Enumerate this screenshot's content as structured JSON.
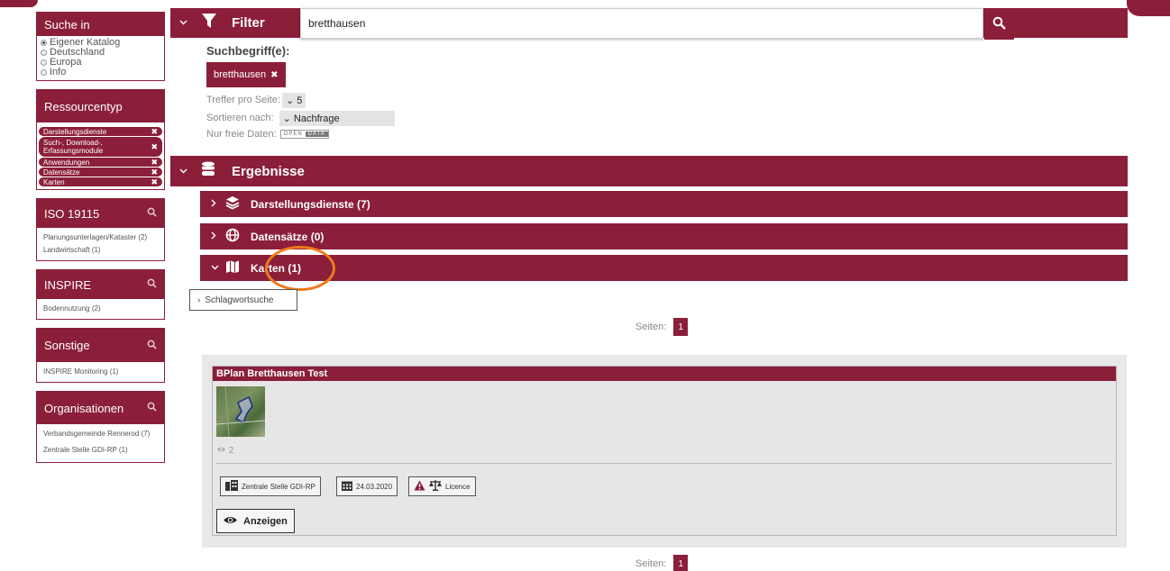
{
  "colors": {
    "brand": "#8b1f3a",
    "highlight": "#f07a1a"
  },
  "sidebar": {
    "search_in": {
      "title": "Suche in",
      "options": [
        {
          "label": "Eigener Katalog",
          "checked": true
        },
        {
          "label": "Deutschland",
          "checked": false
        },
        {
          "label": "Europa",
          "checked": false
        },
        {
          "label": "Info",
          "checked": false
        }
      ]
    },
    "resource_type": {
      "title": "Ressourcentyp",
      "tags": [
        {
          "label": "Darstellungsdienste"
        },
        {
          "label": "Such-, Download-, Erfassungsmodule"
        },
        {
          "label": "Anwendungen"
        },
        {
          "label": "Datensätze"
        },
        {
          "label": "Karten"
        }
      ],
      "remove_icon": "✖"
    },
    "iso": {
      "title": "ISO 19115",
      "items": [
        "Planungsunterlagen/Kataster (2)",
        "Landwirtschaft (1)"
      ]
    },
    "inspire": {
      "title": "INSPIRE",
      "items": [
        "Bodennutzung (2)"
      ]
    },
    "sonstige": {
      "title": "Sonstige",
      "items": [
        "INSPIRE Monitoring (1)"
      ]
    },
    "organisationen": {
      "title": "Organisationen",
      "items": [
        "Verbandsgemeinde Rennerod (7)",
        "Zentrale Stelle GDI-RP (1)"
      ]
    }
  },
  "filter": {
    "title": "Filter",
    "search_value": "bretthausen",
    "search_terms_label": "Suchbegriff(e):",
    "term_chip": "bretthausen",
    "hits_label": "Treffer pro Seite:",
    "hits_value": "5",
    "sort_label": "Sortieren nach:",
    "sort_value": "Nachfrage",
    "free_label": "Nur freie Daten:",
    "open_label": "OPEN",
    "data_label": "DATA"
  },
  "results": {
    "title": "Ergebnisse",
    "groups": [
      {
        "label": "Darstellungsdienste (7)",
        "expanded": false
      },
      {
        "label": "Datensätze (0)",
        "expanded": false
      },
      {
        "label": "Karten (1)",
        "expanded": true
      }
    ],
    "keyword_search": "Schlagwortsuche",
    "pages_label": "Seiten:",
    "current_page": "1",
    "card": {
      "title": "BPlan Bretthausen Test",
      "views": "2",
      "org": "Zentrale Stelle GDI-RP",
      "date": "24.03.2020",
      "licence": "Licence",
      "show_label": "Anzeigen"
    }
  }
}
